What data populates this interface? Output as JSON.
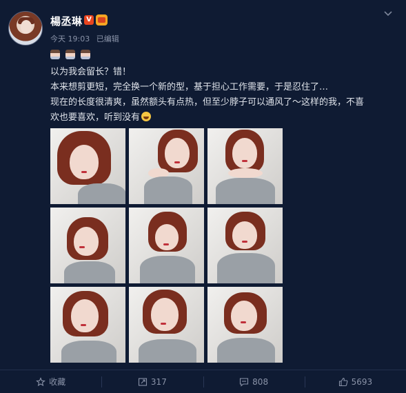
{
  "post": {
    "username": "楊丞琳",
    "verified_badge": "V",
    "timestamp": "今天 19:03",
    "edited": "已编辑",
    "lines": [
      "以为我会留长？错！",
      "本来想剪更短，完全换一个新的型，基于担心工作需要，于是忍住了…",
      "现在的长度很清爽，虽然额头有点热，但至少脖子可以通风了～这样的我，不喜",
      "欢也要喜欢，听到没有"
    ],
    "photo_count": 9
  },
  "footer": {
    "favorite_label": "收藏",
    "repost_count": "317",
    "comment_count": "808",
    "like_count": "5693"
  },
  "icons": {
    "menu": "chevron-down-icon",
    "favorite": "star-icon",
    "repost": "repost-icon",
    "comment": "comment-icon",
    "like": "thumbs-up-icon"
  },
  "colors": {
    "background": "#0f1b33",
    "text": "#dfe3ea",
    "muted": "#8a93a8",
    "badge": "#e8441f"
  }
}
